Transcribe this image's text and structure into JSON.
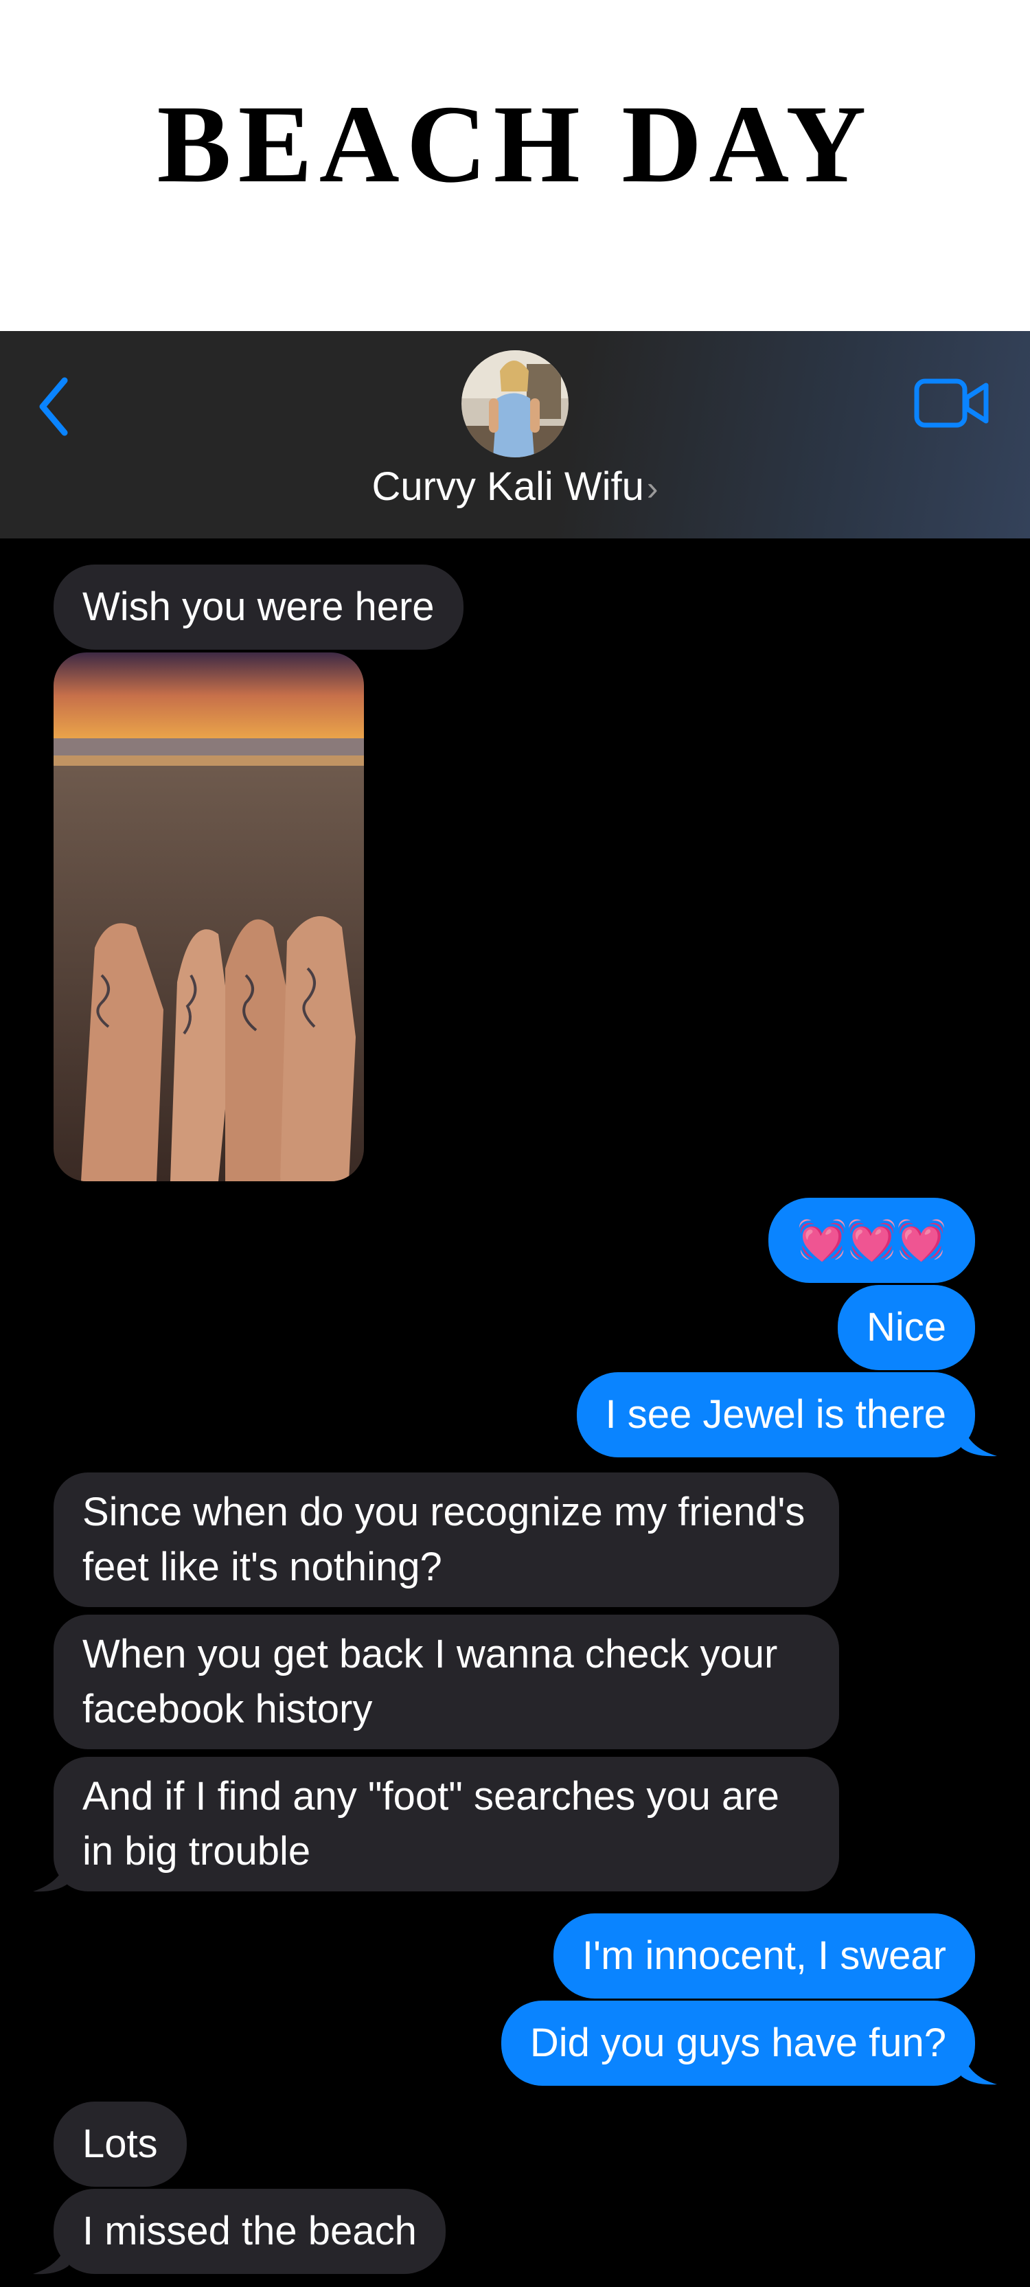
{
  "title": "BEACH DAY",
  "header": {
    "contact_name": "Curvy Kali Wifu",
    "chevron": "›",
    "icons": {
      "back": "chevron-left-icon",
      "video": "video-camera-icon"
    },
    "accent_color": "#0a84ff"
  },
  "messages": [
    {
      "from": "them",
      "text": "Wish you were here"
    },
    {
      "from": "them",
      "type": "photo",
      "description_hidden": true
    },
    {
      "from": "me",
      "text": "💓💓💓"
    },
    {
      "from": "me",
      "text": "Nice"
    },
    {
      "from": "me",
      "text": "I see Jewel is there"
    },
    {
      "from": "them",
      "text": "Since when do you recognize my friend's feet like it's nothing?"
    },
    {
      "from": "them",
      "text": "When you get back I wanna check your facebook history"
    },
    {
      "from": "them",
      "text": "And if I find any \"foot\" searches you are in big trouble"
    },
    {
      "from": "me",
      "text": "I'm innocent, I swear"
    },
    {
      "from": "me",
      "text": "Did you guys have fun?"
    },
    {
      "from": "them",
      "text": "Lots"
    },
    {
      "from": "them",
      "text": "I missed the beach"
    }
  ],
  "colors": {
    "incoming_bubble": "#26252a",
    "outgoing_bubble": "#0a84ff",
    "background": "#000000"
  }
}
